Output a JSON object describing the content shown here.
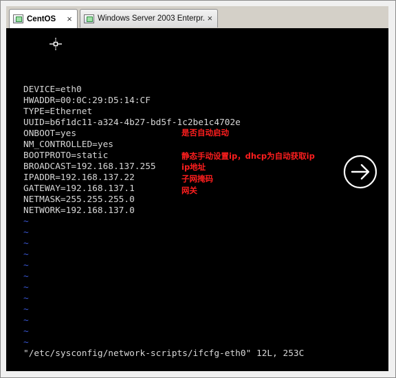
{
  "tabs": [
    {
      "label": "CentOS",
      "close": "×",
      "icon": "vm-icon",
      "active": true
    },
    {
      "label": "Windows Server 2003 Enterpr...",
      "close": "×",
      "icon": "vm-icon",
      "active": false
    }
  ],
  "console": {
    "config_lines": [
      "DEVICE=eth0",
      "HWADDR=00:0C:29:D5:14:CF",
      "TYPE=Ethernet",
      "UUID=b6f1dc11-a324-4b27-bd5f-1c2be1c4702e",
      "ONBOOT=yes",
      "NM_CONTROLLED=yes",
      "BOOTPROTO=static",
      "BROADCAST=192.168.137.255",
      "IPADDR=192.168.137.22",
      "GATEWAY=192.168.137.1",
      "NETMASK=255.255.255.0",
      "NETWORK=192.168.137.0"
    ],
    "tildes": [
      "~",
      "~",
      "~",
      "~",
      "~",
      "~",
      "~",
      "~",
      "~",
      "~",
      "~",
      "~"
    ],
    "status_line": "\"/etc/sysconfig/network-scripts/ifcfg-eth0\" 12L, 253C"
  },
  "annotations": {
    "onboot": "是否自动启动",
    "bootproto": "静态手动设置ip，dhcp为自动获取ip",
    "ipaddr": "ip地址",
    "netmask": "子网掩码",
    "gateway": "网关"
  },
  "colors": {
    "console_bg": "#000000",
    "console_text": "#d8d8d8",
    "tilde": "#3a58d8",
    "annotation": "#ff1e1e"
  },
  "icons": {
    "mouse_cursor": "move-crosshair-icon",
    "next_button": "arrow-right-circle-icon"
  }
}
